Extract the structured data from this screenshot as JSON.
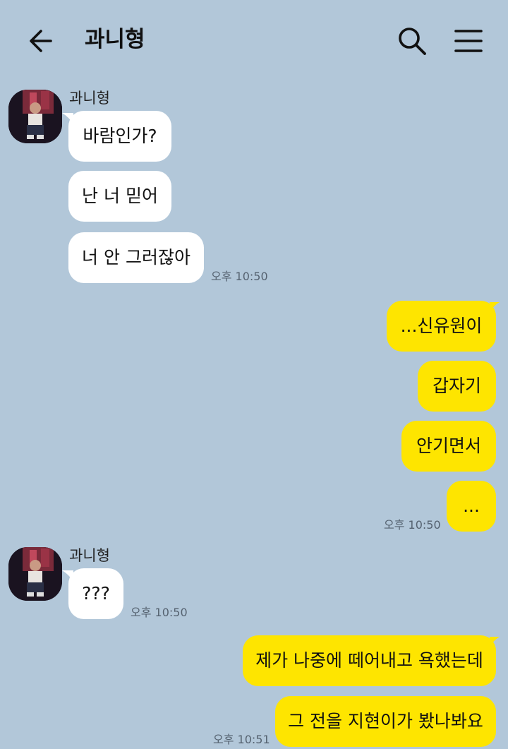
{
  "header": {
    "title": "과니형",
    "back_icon": "arrow-left-icon",
    "search_icon": "search-icon",
    "menu_icon": "hamburger-menu-icon"
  },
  "colors": {
    "background": "#b2c7d9",
    "incoming_bubble": "#ffffff",
    "outgoing_bubble": "#fee500"
  },
  "groups": [
    {
      "sender": "과니형",
      "direction": "in",
      "messages": [
        "바람인가?",
        "난 너 믿어",
        "너 안 그러잖아"
      ],
      "time": "오후 10:50"
    },
    {
      "direction": "out",
      "messages": [
        "...신유원이",
        "갑자기",
        "안기면서",
        "..."
      ],
      "time": "오후 10:50"
    },
    {
      "sender": "과니형",
      "direction": "in",
      "messages": [
        "???"
      ],
      "time": "오후 10:50"
    },
    {
      "direction": "out",
      "messages": [
        "제가 나중에 떼어내고 욕했는데",
        "그 전을 지현이가 봤나봐요"
      ],
      "time": "오후 10:51"
    }
  ]
}
